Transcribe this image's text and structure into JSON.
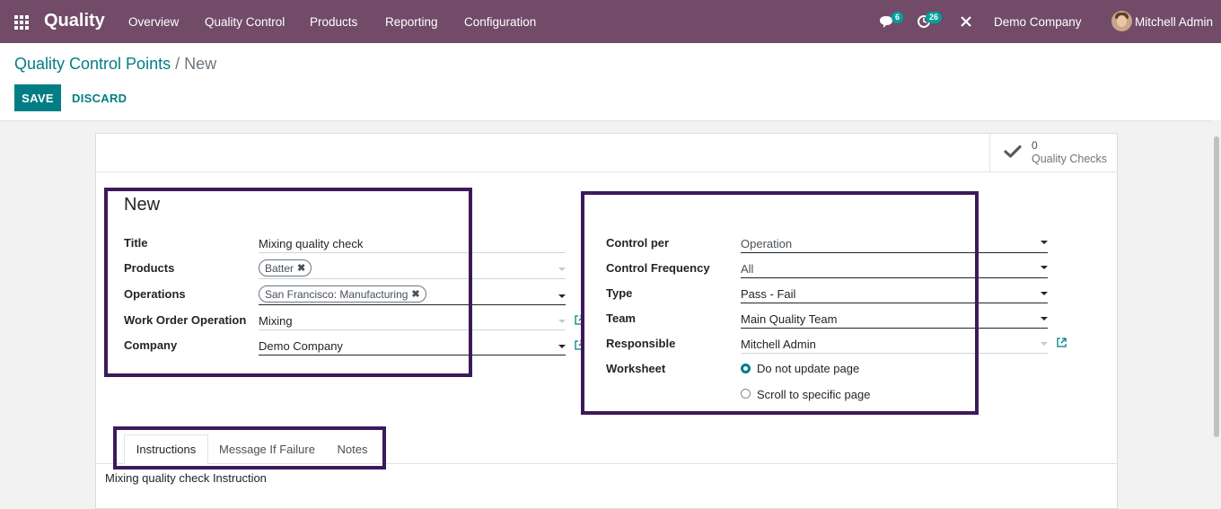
{
  "navbar": {
    "app_name": "Quality",
    "menu": [
      "Overview",
      "Quality Control",
      "Products",
      "Reporting",
      "Configuration"
    ],
    "messages_count": "6",
    "activities_count": "26",
    "company": "Demo Company",
    "user": "Mitchell Admin",
    "colors": {
      "navbar": "#714B67",
      "badge": "#00A09D"
    }
  },
  "control_panel": {
    "breadcrumb_parent": "Quality Control Points",
    "breadcrumb_sep": "/",
    "breadcrumb_current": "New",
    "save_label": "SAVE",
    "discard_label": "DISCARD"
  },
  "stat_button": {
    "value": "0",
    "label": "Quality Checks",
    "icon": "check-icon"
  },
  "form": {
    "title": "New",
    "left": {
      "title_label": "Title",
      "title_value": "Mixing quality check",
      "products_label": "Products",
      "products_tag": "Batter",
      "operations_label": "Operations",
      "operations_tag": "San Francisco: Manufacturing",
      "work_order_label": "Work Order Operation",
      "work_order_value": "Mixing",
      "company_label": "Company",
      "company_value": "Demo Company"
    },
    "right": {
      "control_per_label": "Control per",
      "control_per_value": "Operation",
      "frequency_label": "Control Frequency",
      "frequency_value": "All",
      "type_label": "Type",
      "type_value": "Pass - Fail",
      "team_label": "Team",
      "team_value": "Main Quality Team",
      "responsible_label": "Responsible",
      "responsible_value": "Mitchell Admin",
      "worksheet_label": "Worksheet",
      "worksheet_options": [
        "Do not update page",
        "Scroll to specific page"
      ],
      "worksheet_selected": "Do not update page"
    }
  },
  "tabs": {
    "items": [
      "Instructions",
      "Message If Failure",
      "Notes"
    ],
    "active": "Instructions",
    "content": "Mixing quality check Instruction"
  },
  "colors": {
    "accent": "#017E84",
    "highlight": "#3c1a5a"
  }
}
